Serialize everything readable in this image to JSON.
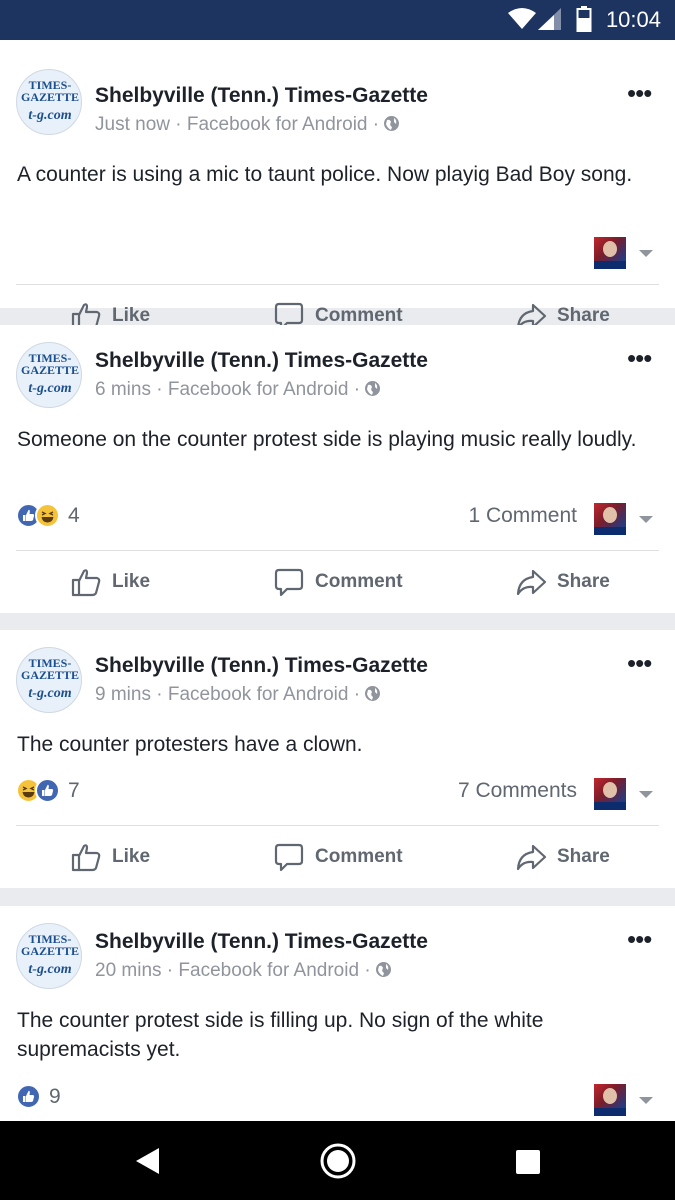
{
  "status_bar": {
    "time": "10:04"
  },
  "actions": {
    "like": "Like",
    "comment": "Comment",
    "share": "Share"
  },
  "page": {
    "name": "Shelbyville (Tenn.) Times-Gazette",
    "logo_line1": "TIMES-",
    "logo_line2": "GAZETTE",
    "logo_site": "t-g.com"
  },
  "posts": [
    {
      "time": "Just now",
      "via": "Facebook for Android",
      "text": "A counter is using a mic to taunt police. Now playig Bad Boy song.",
      "reactions": [],
      "reaction_count": "",
      "comment_count": ""
    },
    {
      "time": "6 mins",
      "via": "Facebook for Android",
      "text": "Someone on the counter protest side is playing music really loudly.",
      "reactions": [
        "like",
        "haha"
      ],
      "reaction_count": "4",
      "comment_count": "1 Comment"
    },
    {
      "time": "9 mins",
      "via": "Facebook for Android",
      "text": "The counter protesters have a clown.",
      "reactions": [
        "haha",
        "like"
      ],
      "reaction_count": "7",
      "comment_count": "7 Comments"
    },
    {
      "time": "20 mins",
      "via": "Facebook for Android",
      "text": "The counter protest side is filling up. No sign of the white supremacists yet.",
      "reactions": [
        "like"
      ],
      "reaction_count": "9",
      "comment_count": ""
    }
  ],
  "colors": {
    "status_bar": "#1d3461",
    "like_blue": "#4267b2",
    "haha_yellow": "#f5c33b",
    "feed_bg": "#e9ebee"
  }
}
